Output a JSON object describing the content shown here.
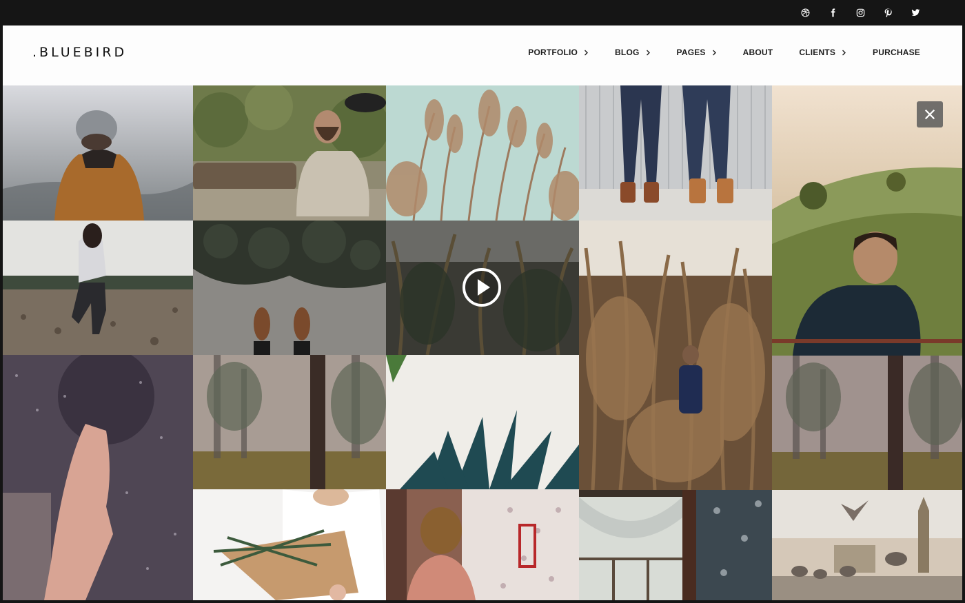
{
  "brand": {
    "logo": ".BLUEBIRD"
  },
  "social": [
    {
      "name": "dribbble",
      "icon": "dribbble-icon"
    },
    {
      "name": "facebook",
      "icon": "facebook-icon"
    },
    {
      "name": "instagram",
      "icon": "instagram-icon"
    },
    {
      "name": "pinterest",
      "icon": "pinterest-icon"
    },
    {
      "name": "twitter",
      "icon": "twitter-icon"
    }
  ],
  "nav": {
    "items": [
      {
        "label": "PORTFOLIO",
        "has_submenu": true
      },
      {
        "label": "BLOG",
        "has_submenu": true
      },
      {
        "label": "PAGES",
        "has_submenu": true
      },
      {
        "label": "ABOUT",
        "has_submenu": false
      },
      {
        "label": "CLIENTS",
        "has_submenu": true
      },
      {
        "label": "PURCHASE",
        "has_submenu": false
      }
    ]
  },
  "gallery": {
    "tiles": [
      {
        "subject": "person in knit beanie and brown jacket, foggy background"
      },
      {
        "subject": "bearded man sitting by a log, holding a hat"
      },
      {
        "subject": "dry grass stalks against pale sky"
      },
      {
        "subject": "two pairs of legs in jeans and boots against a metal wall"
      },
      {
        "subject": "man looking over misty green hills at sunset"
      },
      {
        "subject": "person running on a rocky beach"
      },
      {
        "subject": "feet in boots on pavement beneath foliage"
      },
      {
        "subject": "dark cornfield video thumbnail",
        "video": true
      },
      {
        "subject": "child walking through a dry cornfield"
      },
      {
        "subject": "hand pressed against a rainy window"
      },
      {
        "subject": "misty pine forest"
      },
      {
        "subject": "agave plant against a white wall"
      },
      {
        "subject": "misty pine forest"
      },
      {
        "subject": "woman holding evergreen branches wrapped in paper"
      },
      {
        "subject": "girl in a room with floral wallpaper"
      },
      {
        "subject": "window with sheer curtain and floral wallpaper"
      },
      {
        "subject": "pigeons and seagull by Big Ben"
      }
    ]
  },
  "controls": {
    "play": "play-icon",
    "close": "close-icon"
  },
  "colors": {
    "topbar": "#151515",
    "header": "#fdfdfd",
    "text": "#1d1d1d"
  }
}
